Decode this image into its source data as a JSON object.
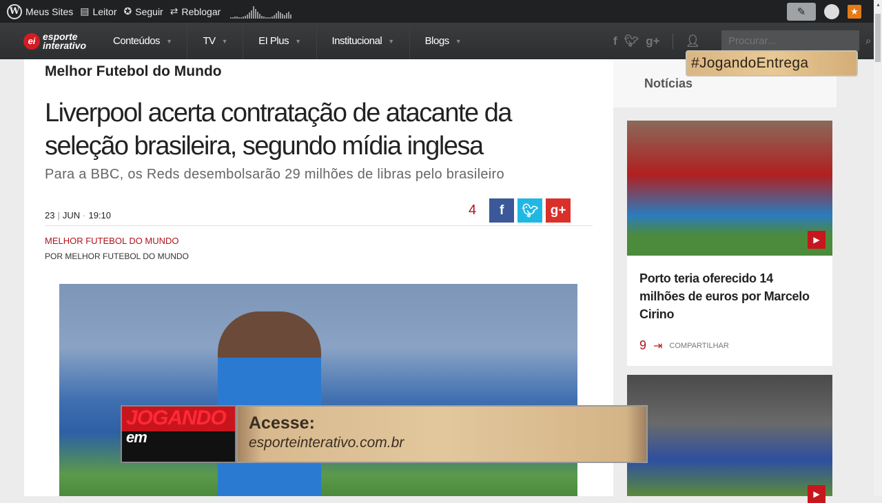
{
  "admin_bar": {
    "my_sites": "Meus Sites",
    "reader": "Leitor",
    "follow": "Seguir",
    "reblog": "Reblogar"
  },
  "nav": {
    "logo_top": "esporte",
    "logo_bottom": "interativo",
    "logo_mark": "ei",
    "items": [
      "Conteúdos",
      "TV",
      "EI Plus",
      "Institucional",
      "Blogs"
    ],
    "search_placeholder": "Procurar..."
  },
  "article": {
    "section": "Melhor Futebol do Mundo",
    "title": "Liverpool acerta contratação de atacante da seleção brasileira, segundo mídia inglesa",
    "subtitle": "Para a BBC, os Reds desembolsarão 29 milhões de libras pelo brasileiro",
    "day": "23",
    "month": "JUN",
    "time": "19:10",
    "share_count": "4",
    "category": "MELHOR FUTEBOL DO MUNDO",
    "byline": "POR MELHOR FUTEBOL DO MUNDO"
  },
  "sidebar": {
    "heading": "Notícias",
    "cards": [
      {
        "title": "Porto teria oferecido 14 milhões de euros por Marcelo Cirino",
        "count": "9",
        "share_label": "COMPARTILHAR"
      }
    ]
  },
  "overlay": {
    "hashtag": "#JogandoEntrega",
    "brand_top": "JOGANDO",
    "brand_bottom": "em",
    "cta": "Acesse:",
    "url": "esporteinterativo.com.br"
  },
  "colors": {
    "accent": "#b0121b",
    "facebook": "#3b5998",
    "twitter": "#1fb8e3",
    "gplus": "#d9302a"
  }
}
